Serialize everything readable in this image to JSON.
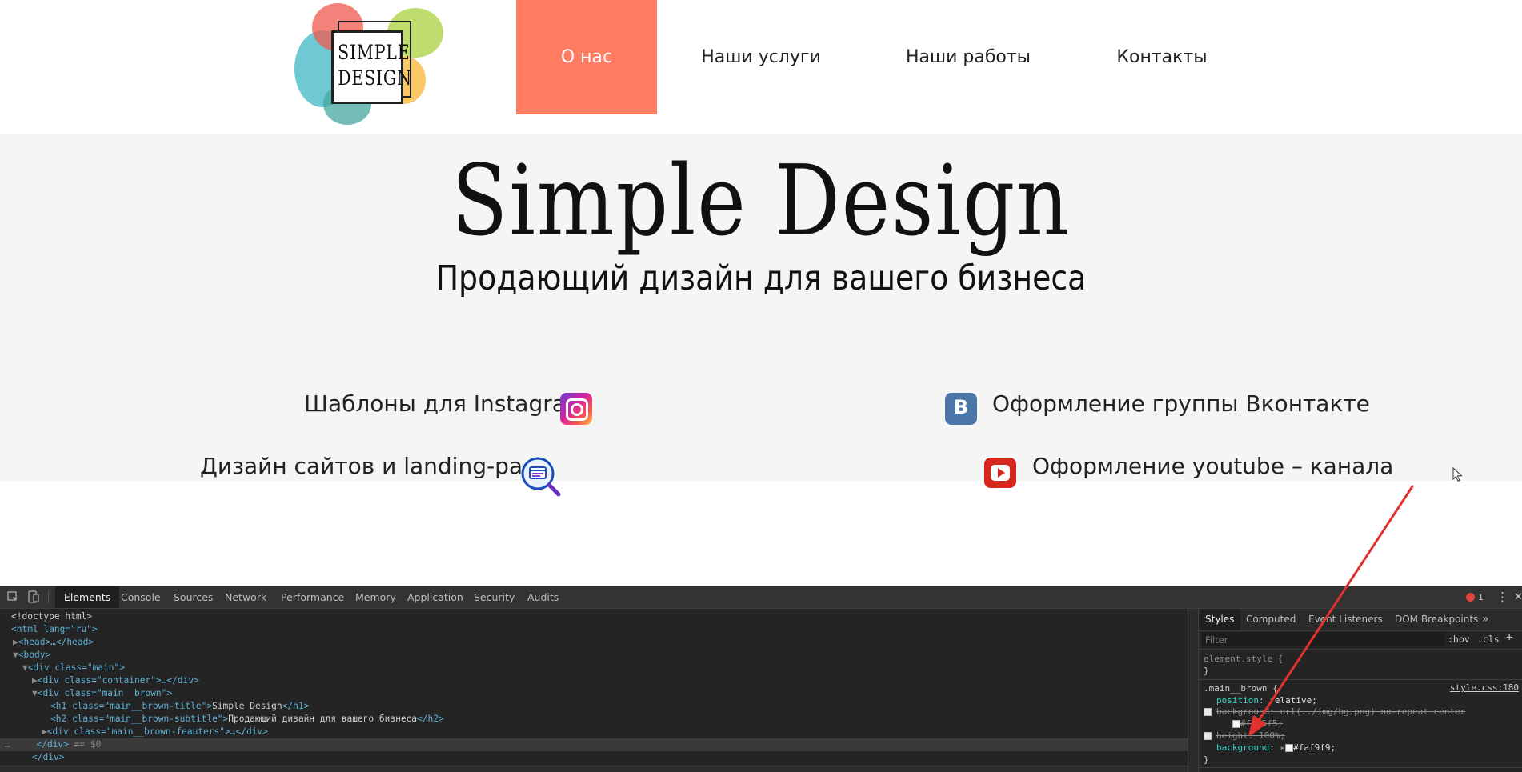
{
  "site": {
    "logo": {
      "line1": "SIMPLE",
      "line2": "DESIGN"
    },
    "nav": [
      {
        "label": "О нас",
        "active": true
      },
      {
        "label": "Наши услуги",
        "active": false
      },
      {
        "label": "Наши работы",
        "active": false
      },
      {
        "label": "Контакты",
        "active": false
      }
    ],
    "hero": {
      "title": "Simple Design",
      "subtitle": "Продающий дизайн для вашего бизнеса"
    },
    "features": [
      {
        "label": "Шаблоны для Instagram",
        "icon": "instagram-icon"
      },
      {
        "label": "Оформление группы Вконтакте",
        "icon": "vk-icon"
      },
      {
        "label": "Дизайн сайтов и landing-page",
        "icon": "web-search-icon"
      },
      {
        "label": "Оформление youtube – канала",
        "icon": "youtube-icon"
      }
    ],
    "colors": {
      "accent": "#ff7b61",
      "hero_bg": "#f5f5f5",
      "arrow": "#e03131"
    }
  },
  "devtools": {
    "tabs": [
      "Elements",
      "Console",
      "Sources",
      "Network",
      "Performance",
      "Memory",
      "Application",
      "Security",
      "Audits"
    ],
    "active_tab": "Elements",
    "error_count": "1",
    "dom": {
      "doctype": "<!doctype html>",
      "html_open": "<html lang=\"ru\">",
      "head": "<head>…</head>",
      "body": "<body>",
      "main": "<div class=\"main\">",
      "container": "<div class=\"container\">…</div>",
      "brown": "<div class=\"main__brown\">",
      "h1_tag_open": "<h1 class=\"main__brown-title\">",
      "h1_text": "Simple Design",
      "h1_tag_close": "</h1>",
      "h2_tag_open": "<h2 class=\"main__brown-subtitle\">",
      "h2_text": "Продающий дизайн для вашего бизнеса",
      "h2_tag_close": "</h2>",
      "features": "<div class=\"main__brown-feauters\">…</div>",
      "close_div_selected": "</div>",
      "selected_marker": "== $0",
      "close_div": "</div>"
    },
    "styles": {
      "tabs": [
        "Styles",
        "Computed",
        "Event Listeners",
        "DOM Breakpoints"
      ],
      "active_tab": "Styles",
      "filter_placeholder": "Filter",
      "hov": ":hov",
      "cls": ".cls",
      "element_style": "element.style {",
      "close_brace": "}",
      "rule_selector": ".main__brown {",
      "rule_source": "style.css:180",
      "declarations": [
        {
          "prop": "position",
          "value": "relative;",
          "struck": false
        },
        {
          "prop": "background",
          "value": "url(../img/bg.png) no-repeat center",
          "struck": true
        },
        {
          "prop": "",
          "value": "#f5f5f5;",
          "struck": true,
          "swatch": "#f5f5f5"
        },
        {
          "prop": "height",
          "value": "100%;",
          "struck": true
        },
        {
          "prop": "background",
          "value": "#faf9f9;",
          "struck": false,
          "swatch": "#faf9f9"
        }
      ]
    }
  }
}
